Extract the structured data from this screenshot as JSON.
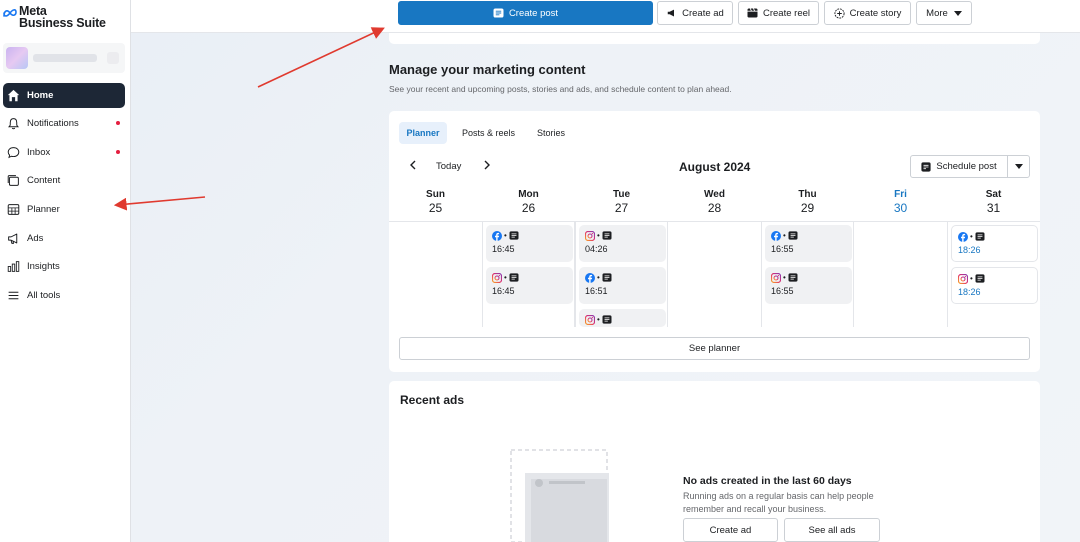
{
  "app": {
    "logo_line1": "Meta",
    "logo_line2": "Business Suite"
  },
  "sidebar": {
    "items": [
      {
        "label": "Home",
        "icon": "home-icon",
        "active": true
      },
      {
        "label": "Notifications",
        "icon": "bell-icon",
        "badge": true
      },
      {
        "label": "Inbox",
        "icon": "chat-bubble-icon",
        "badge": true
      },
      {
        "label": "Content",
        "icon": "content-stack-icon"
      },
      {
        "label": "Planner",
        "icon": "calendar-grid-icon"
      },
      {
        "label": "Ads",
        "icon": "megaphone-icon"
      },
      {
        "label": "Insights",
        "icon": "bar-chart-icon"
      },
      {
        "label": "All tools",
        "icon": "hamburger-menu-icon"
      }
    ]
  },
  "toolbar": {
    "create_post": "Create post",
    "create_ad": "Create ad",
    "create_reel": "Create reel",
    "create_story": "Create story",
    "more": "More"
  },
  "marketing": {
    "title": "Manage your marketing content",
    "subtitle": "See your recent and upcoming posts, stories and ads, and schedule content to plan ahead."
  },
  "planner": {
    "tabs": [
      "Planner",
      "Posts & reels",
      "Stories"
    ],
    "today_label": "Today",
    "month": "August 2024",
    "schedule_label": "Schedule post",
    "see_planner": "See planner",
    "days": [
      {
        "name": "Sun",
        "num": "25",
        "posts": []
      },
      {
        "name": "Mon",
        "num": "26",
        "posts": [
          {
            "platform": "facebook",
            "time": "16:45"
          },
          {
            "platform": "instagram",
            "time": "16:45"
          }
        ]
      },
      {
        "name": "Tue",
        "num": "27",
        "posts": [
          {
            "platform": "instagram",
            "time": "04:26"
          },
          {
            "platform": "facebook",
            "time": "16:51"
          },
          {
            "platform": "instagram",
            "time": ""
          }
        ]
      },
      {
        "name": "Wed",
        "num": "28",
        "posts": []
      },
      {
        "name": "Thu",
        "num": "29",
        "posts": [
          {
            "platform": "facebook",
            "time": "16:55"
          },
          {
            "platform": "instagram",
            "time": "16:55"
          }
        ]
      },
      {
        "name": "Fri",
        "num": "30",
        "today": true,
        "posts": []
      },
      {
        "name": "Sat",
        "num": "31",
        "scheduled": true,
        "posts": [
          {
            "platform": "facebook",
            "time": "18:26"
          },
          {
            "platform": "instagram",
            "time": "18:26"
          }
        ]
      }
    ],
    "separator": "•"
  },
  "ads": {
    "title": "Recent ads",
    "empty_title": "No ads created in the last 60 days",
    "empty_text": "Running ads on a regular basis can help people remember and recall your business.",
    "create_ad": "Create ad",
    "see_all": "See all ads"
  },
  "colors": {
    "accent": "#1877c2",
    "nav_active": "#1d2736",
    "badge": "#e41e3f",
    "annotation_arrow": "#e03a2f"
  }
}
